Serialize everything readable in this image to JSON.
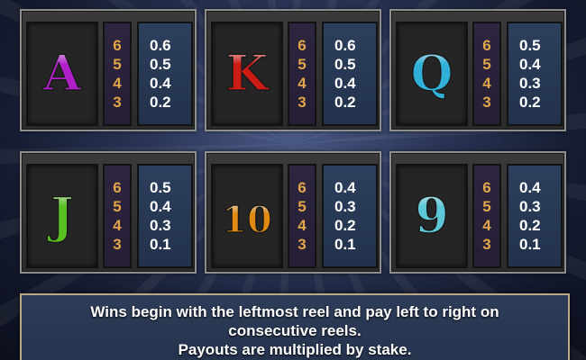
{
  "paytable": [
    {
      "symbol": "A",
      "icon": "purple-letter-a-icon",
      "color": "#b020c8",
      "counts": [
        "6",
        "5",
        "4",
        "3"
      ],
      "payouts": [
        "0.6",
        "0.5",
        "0.4",
        "0.2"
      ]
    },
    {
      "symbol": "K",
      "icon": "red-letter-k-icon",
      "color": "#cc1a14",
      "counts": [
        "6",
        "5",
        "4",
        "3"
      ],
      "payouts": [
        "0.6",
        "0.5",
        "0.4",
        "0.2"
      ]
    },
    {
      "symbol": "Q",
      "icon": "cyan-letter-q-icon",
      "color": "#30b0d8",
      "counts": [
        "6",
        "5",
        "4",
        "3"
      ],
      "payouts": [
        "0.5",
        "0.4",
        "0.3",
        "0.2"
      ]
    },
    {
      "symbol": "J",
      "icon": "green-letter-j-icon",
      "color": "#58c020",
      "counts": [
        "6",
        "5",
        "4",
        "3"
      ],
      "payouts": [
        "0.5",
        "0.4",
        "0.3",
        "0.1"
      ]
    },
    {
      "symbol": "10",
      "icon": "gold-number-10-icon",
      "color": "#e08a12",
      "counts": [
        "6",
        "5",
        "4",
        "3"
      ],
      "payouts": [
        "0.4",
        "0.3",
        "0.2",
        "0.1"
      ]
    },
    {
      "symbol": "9",
      "icon": "teal-number-9-icon",
      "color": "#5ec8d8",
      "counts": [
        "6",
        "5",
        "4",
        "3"
      ],
      "payouts": [
        "0.4",
        "0.3",
        "0.2",
        "0.1"
      ]
    }
  ],
  "rules": {
    "line1": "Wins begin with the leftmost reel and pay left to right on",
    "line2": "consecutive reels.",
    "line3": "Payouts are multiplied by stake."
  }
}
